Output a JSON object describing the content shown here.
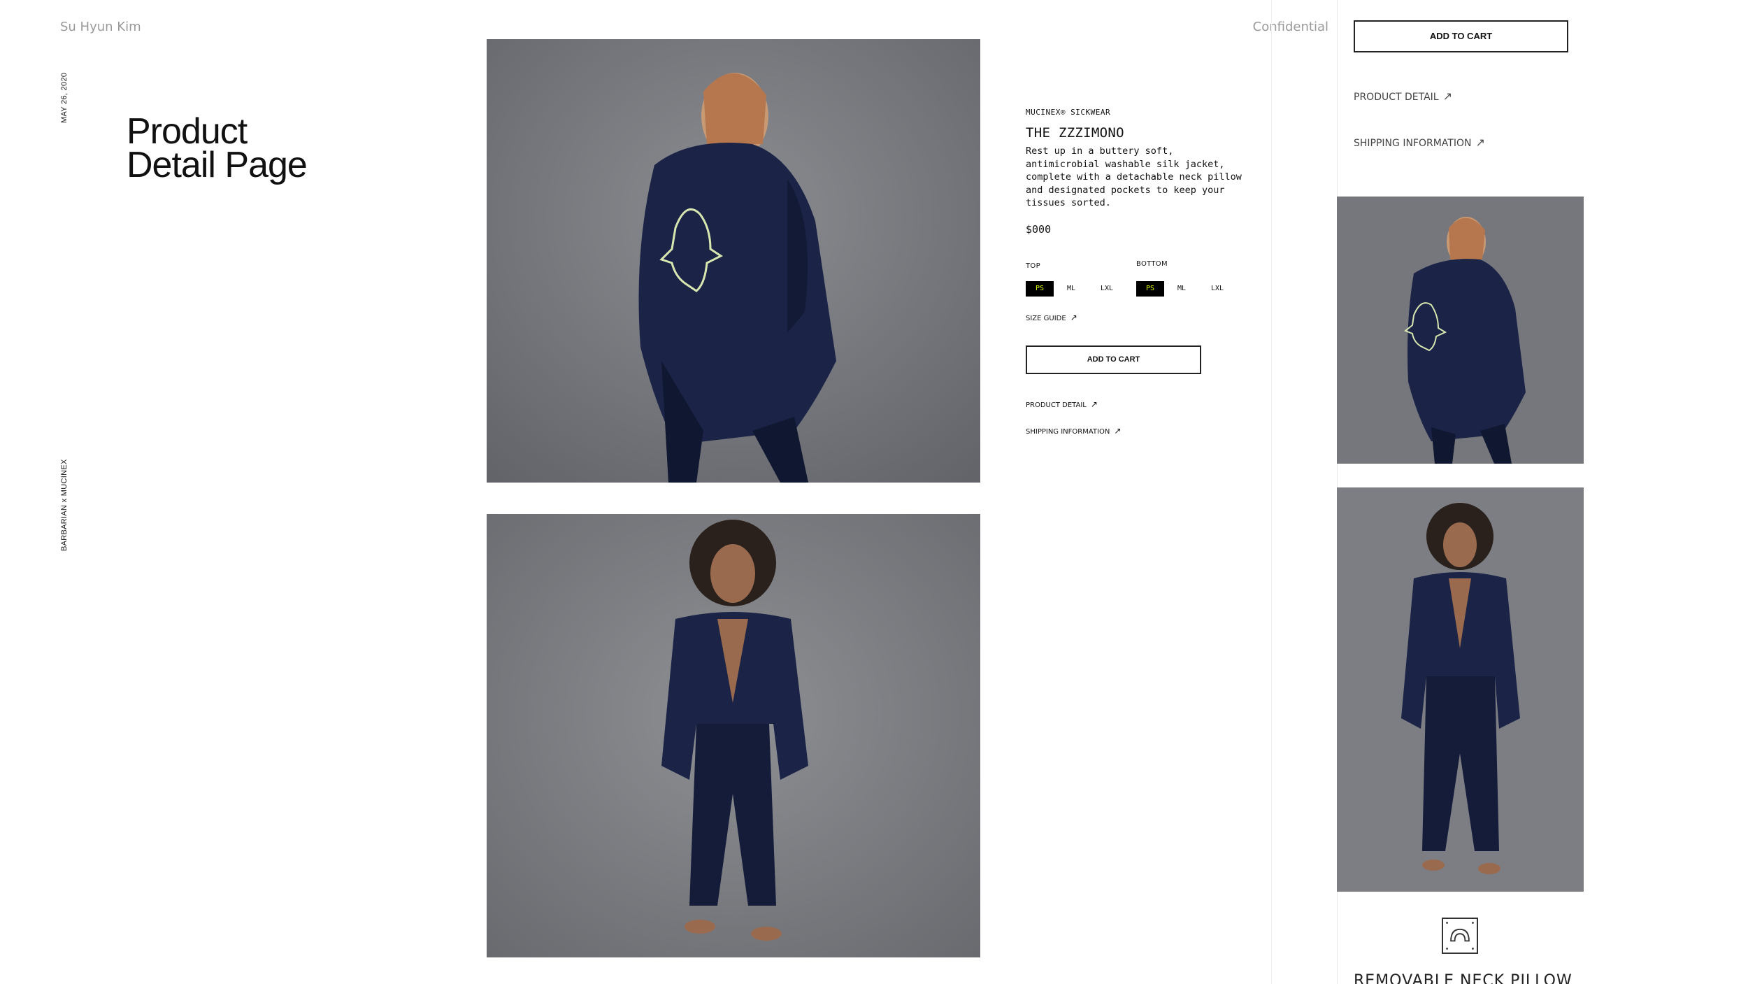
{
  "header": {
    "author": "Su Hyun Kim",
    "confidential": "Confidential"
  },
  "side_text": {
    "date": "MAY 26, 2020",
    "brand": "BARBARIAN x MUCINEX"
  },
  "page_title_line1": "Product",
  "page_title_line2": "Detail Page",
  "product": {
    "brand": "MUCINEX® SICKWEAR",
    "name": "THE ZZZIMONO",
    "description": "Rest up in a buttery soft, antimicrobial washable silk jacket, complete with a detachable neck pillow and designated pockets to keep your tissues sorted.",
    "price": "$000",
    "top_label": "TOP",
    "bottom_label": "BOTTOM",
    "top_sizes": [
      "PS",
      "ML",
      "LXL"
    ],
    "bottom_sizes": [
      "PS",
      "ML",
      "LXL"
    ],
    "selected_top": "PS",
    "selected_bottom": "PS",
    "size_guide": "SIZE GUIDE",
    "add_to_cart": "ADD TO CART",
    "product_detail": "PRODUCT DETAIL",
    "shipping_information": "SHIPPING INFORMATION"
  },
  "mobile_panel": {
    "add_to_cart": "ADD TO CART",
    "product_detail": "PRODUCT DETAIL",
    "shipping_information": "SHIPPING INFORMATION",
    "feature_title": "REMOVABLE NECK PILLOW"
  },
  "icons": {
    "arrow": "arrow-up-right-icon",
    "pillow": "neck-pillow-icon"
  },
  "colors": {
    "selected_bg": "#000000",
    "selected_text": "#d8f400",
    "jacket": "#1b2447"
  }
}
